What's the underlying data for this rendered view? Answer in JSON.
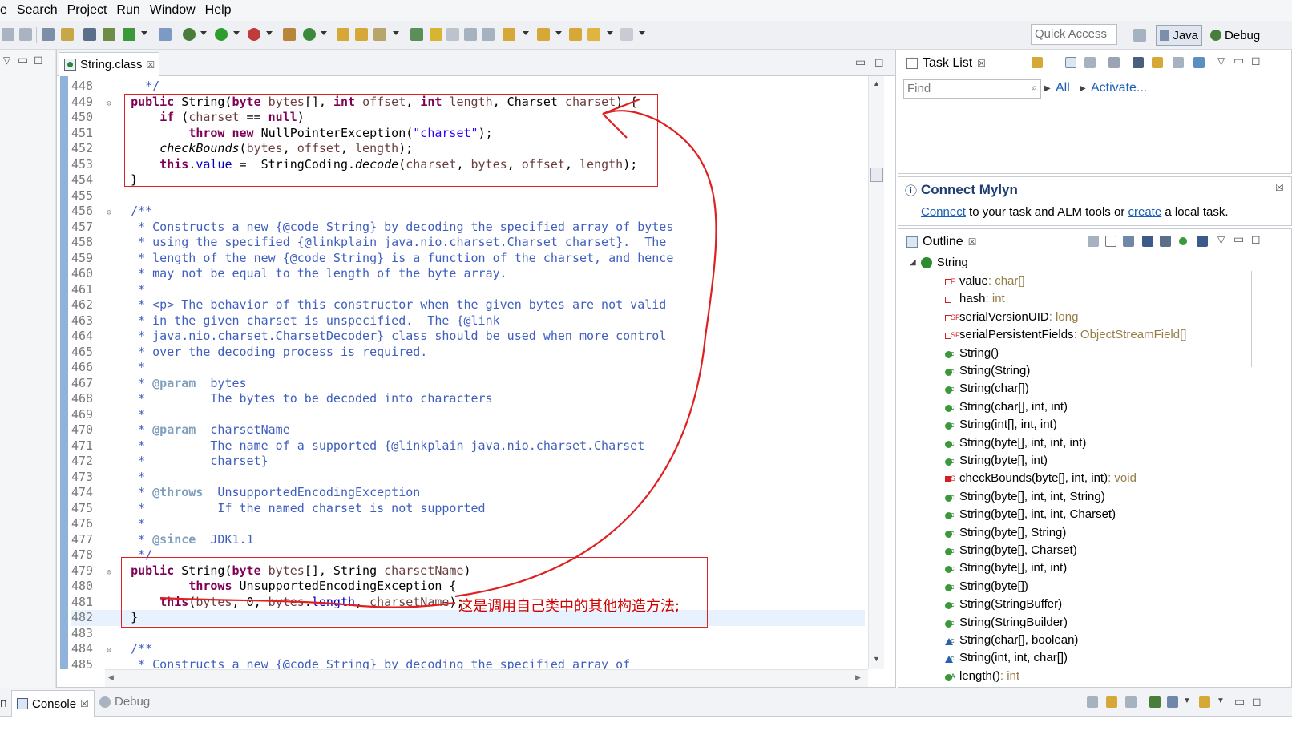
{
  "menu": [
    "e",
    "Search",
    "Project",
    "Run",
    "Window",
    "Help"
  ],
  "quick_access_placeholder": "Quick Access",
  "perspectives": [
    {
      "label": "Java",
      "icon": "java-perspective-icon",
      "active": true
    },
    {
      "label": "Debug",
      "icon": "debug-perspective-icon",
      "active": false
    }
  ],
  "editor": {
    "tab_label": "String.class",
    "tab_close": "☒",
    "lines": [
      {
        "n": "448",
        "fold": "",
        "html": "    <span class='cm'>*/</span>"
      },
      {
        "n": "449",
        "fold": "⊖",
        "html": "  <span class='kw'>public</span> String(<span class='kw'>byte</span> <span class='pm'>bytes</span>[], <span class='kw'>int</span> <span class='pm'>offset</span>, <span class='kw'>int</span> <span class='pm'>length</span>, Charset <span class='pm'>charset</span>) {"
      },
      {
        "n": "450",
        "fold": "",
        "html": "      <span class='kw'>if</span> (<span class='pm'>charset</span> == <span class='kw'>null</span>)"
      },
      {
        "n": "451",
        "fold": "",
        "html": "          <span class='kw'>throw</span> <span class='kw'>new</span> NullPointerException(<span class='st'>\"charset\"</span>);"
      },
      {
        "n": "452",
        "fold": "",
        "html": "      <span class='it'>checkBounds</span>(<span class='pm'>bytes</span>, <span class='pm'>offset</span>, <span class='pm'>length</span>);"
      },
      {
        "n": "453",
        "fold": "",
        "html": "      <span class='kw'>this</span>.<span class='fld'>value</span> =  StringCoding.<span class='it'>decode</span>(<span class='pm'>charset</span>, <span class='pm'>bytes</span>, <span class='pm'>offset</span>, <span class='pm'>length</span>);"
      },
      {
        "n": "454",
        "fold": "",
        "html": "  }"
      },
      {
        "n": "455",
        "fold": "",
        "html": ""
      },
      {
        "n": "456",
        "fold": "⊖",
        "html": "  <span class='cm'>/**</span>"
      },
      {
        "n": "457",
        "fold": "",
        "html": "<span class='cm'>   * Constructs a new {@code String} by decoding the specified array of bytes</span>"
      },
      {
        "n": "458",
        "fold": "",
        "html": "<span class='cm'>   * using the specified {@linkplain java.nio.charset.Charset charset}.  The</span>"
      },
      {
        "n": "459",
        "fold": "",
        "html": "<span class='cm'>   * length of the new {@code String} is a function of the charset, and hence</span>"
      },
      {
        "n": "460",
        "fold": "",
        "html": "<span class='cm'>   * may not be equal to the length of the byte array.</span>"
      },
      {
        "n": "461",
        "fold": "",
        "html": "<span class='cm'>   *</span>"
      },
      {
        "n": "462",
        "fold": "",
        "html": "<span class='cm'>   * &lt;p&gt; The behavior of this constructor when the given bytes are not valid</span>"
      },
      {
        "n": "463",
        "fold": "",
        "html": "<span class='cm'>   * in the given charset is unspecified.  The {@link</span>"
      },
      {
        "n": "464",
        "fold": "",
        "html": "<span class='cm'>   * java.nio.charset.CharsetDecoder} class should be used when more control</span>"
      },
      {
        "n": "465",
        "fold": "",
        "html": "<span class='cm'>   * over the decoding process is required.</span>"
      },
      {
        "n": "466",
        "fold": "",
        "html": "<span class='cm'>   *</span>"
      },
      {
        "n": "467",
        "fold": "",
        "html": "<span class='cm'>   * </span><span class='jd'>@param</span><span class='cm'>  bytes</span>"
      },
      {
        "n": "468",
        "fold": "",
        "html": "<span class='cm'>   *         The bytes to be decoded into characters</span>"
      },
      {
        "n": "469",
        "fold": "",
        "html": "<span class='cm'>   *</span>"
      },
      {
        "n": "470",
        "fold": "",
        "html": "<span class='cm'>   * </span><span class='jd'>@param</span><span class='cm'>  charsetName</span>"
      },
      {
        "n": "471",
        "fold": "",
        "html": "<span class='cm'>   *         The name of a supported {@linkplain java.nio.charset.Charset</span>"
      },
      {
        "n": "472",
        "fold": "",
        "html": "<span class='cm'>   *         charset}</span>"
      },
      {
        "n": "473",
        "fold": "",
        "html": "<span class='cm'>   *</span>"
      },
      {
        "n": "474",
        "fold": "",
        "html": "<span class='cm'>   * </span><span class='jd'>@throws</span><span class='cm'>  UnsupportedEncodingException</span>"
      },
      {
        "n": "475",
        "fold": "",
        "html": "<span class='cm'>   *          If the named charset is not supported</span>"
      },
      {
        "n": "476",
        "fold": "",
        "html": "<span class='cm'>   *</span>"
      },
      {
        "n": "477",
        "fold": "",
        "html": "<span class='cm'>   * </span><span class='jd'>@since</span><span class='cm'>  JDK1.1</span>"
      },
      {
        "n": "478",
        "fold": "",
        "html": "<span class='cm'>   */</span>"
      },
      {
        "n": "479",
        "fold": "⊖",
        "html": "  <span class='kw'>public</span> String(<span class='kw'>byte</span> <span class='pm'>bytes</span>[], String <span class='pm'>charsetName</span>)"
      },
      {
        "n": "480",
        "fold": "",
        "html": "          <span class='kw'>throws</span> UnsupportedEncodingException {"
      },
      {
        "n": "481",
        "fold": "",
        "html": "      <span class='kw'>this</span>(<span class='pm'>bytes</span>, 0, <span class='pm'>bytes</span>.<span class='fld'>length</span>, <span class='pm'>charsetName</span>);"
      },
      {
        "n": "482",
        "fold": "",
        "html": "  }"
      },
      {
        "n": "483",
        "fold": "",
        "html": ""
      },
      {
        "n": "484",
        "fold": "⊖",
        "html": "  <span class='cm'>/**</span>"
      },
      {
        "n": "485",
        "fold": "",
        "html": "<span class='cm'>   * Constructs a new {@code String} by decoding the specified array of</span>"
      }
    ]
  },
  "annotation_text": "这是调用自己类中的其他构造方法;",
  "task_list": {
    "tab_label": "Task List",
    "find_placeholder": "Find",
    "all_label": "All",
    "activate_label": "Activate..."
  },
  "mylyn": {
    "title": "Connect Mylyn",
    "connect_link": "Connect",
    "desc_mid": " to your task and ALM tools or ",
    "create_link": "create",
    "desc_end": " a local task."
  },
  "outline": {
    "tab_label": "Outline",
    "root": "String",
    "items": [
      {
        "label": "value",
        "type": " : char[]",
        "kind": "private-final"
      },
      {
        "label": "hash",
        "type": " : int",
        "kind": "private"
      },
      {
        "label": "serialVersionUID",
        "type": " : long",
        "kind": "private-static-final"
      },
      {
        "label": "serialPersistentFields",
        "type": " : ObjectStreamField[]",
        "kind": "private-static-final"
      },
      {
        "label": "String()",
        "type": "",
        "kind": "public-ctor"
      },
      {
        "label": "String(String)",
        "type": "",
        "kind": "public-ctor"
      },
      {
        "label": "String(char[])",
        "type": "",
        "kind": "public-ctor"
      },
      {
        "label": "String(char[], int, int)",
        "type": "",
        "kind": "public-ctor"
      },
      {
        "label": "String(int[], int, int)",
        "type": "",
        "kind": "public-ctor"
      },
      {
        "label": "String(byte[], int, int, int)",
        "type": "",
        "kind": "deprecated-ctor"
      },
      {
        "label": "String(byte[], int)",
        "type": "",
        "kind": "deprecated-ctor"
      },
      {
        "label": "checkBounds(byte[], int, int)",
        "type": " : void",
        "kind": "private-static"
      },
      {
        "label": "String(byte[], int, int, String)",
        "type": "",
        "kind": "public-ctor"
      },
      {
        "label": "String(byte[], int, int, Charset)",
        "type": "",
        "kind": "public-ctor"
      },
      {
        "label": "String(byte[], String)",
        "type": "",
        "kind": "public-ctor"
      },
      {
        "label": "String(byte[], Charset)",
        "type": "",
        "kind": "public-ctor"
      },
      {
        "label": "String(byte[], int, int)",
        "type": "",
        "kind": "public-ctor"
      },
      {
        "label": "String(byte[])",
        "type": "",
        "kind": "public-ctor"
      },
      {
        "label": "String(StringBuffer)",
        "type": "",
        "kind": "public-ctor"
      },
      {
        "label": "String(StringBuilder)",
        "type": "",
        "kind": "public-ctor"
      },
      {
        "label": "String(char[], boolean)",
        "type": "",
        "kind": "default-ctor"
      },
      {
        "label": "String(int, int, char[])",
        "type": "",
        "kind": "default-ctor"
      },
      {
        "label": "length()",
        "type": " : int",
        "kind": "public-method"
      }
    ]
  },
  "bottom_tabs": [
    {
      "label": "n",
      "icon": "",
      "active": false
    },
    {
      "label": "Console",
      "icon": "console-icon",
      "active": true
    },
    {
      "label": "Debug",
      "icon": "debug-icon",
      "active": false
    }
  ],
  "colors": {
    "keyword": "#7f0055",
    "comment": "#3f5fbf",
    "string": "#2a00ff",
    "annotation_red": "#e02020",
    "link": "#1a5fb4"
  }
}
